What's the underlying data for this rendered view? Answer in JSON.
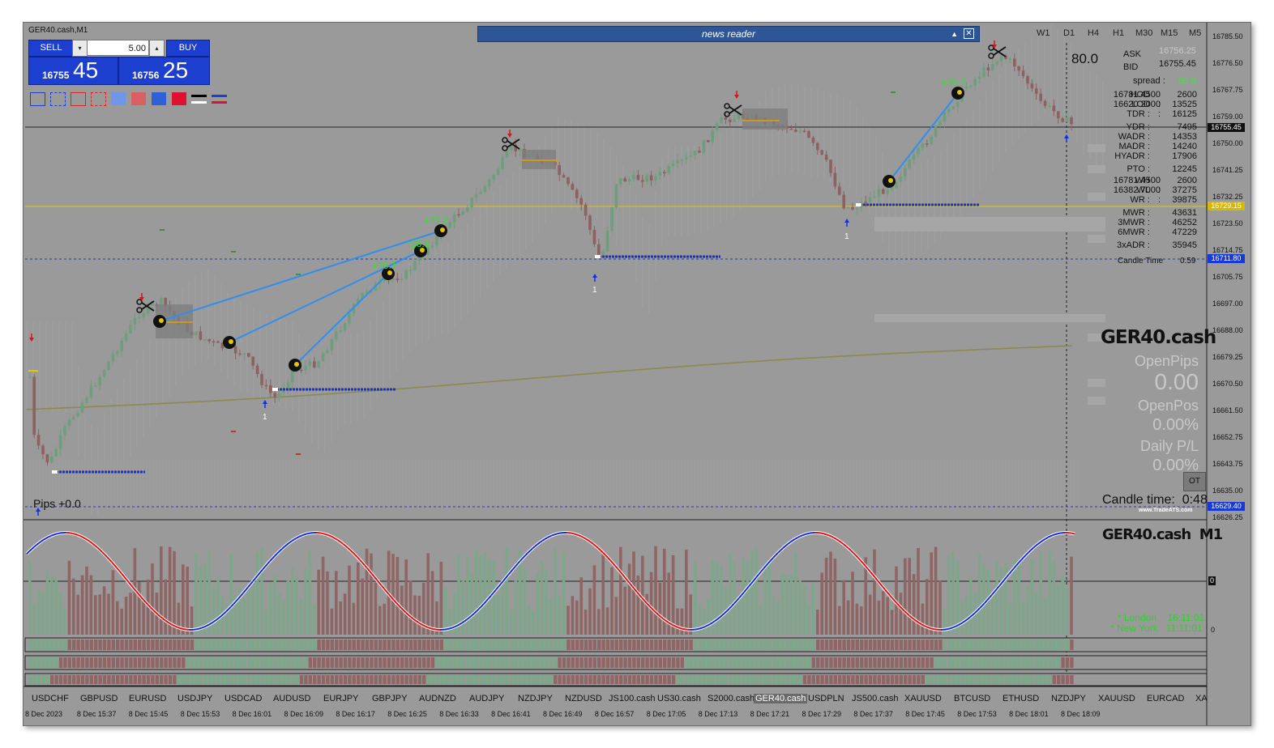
{
  "window": {
    "title": "GER40.cash,M1"
  },
  "trade_panel": {
    "sell_label": "SELL",
    "buy_label": "BUY",
    "lot": "5.00",
    "sell_small": "16755",
    "sell_big": "45",
    "buy_small": "16756",
    "buy_big": "25",
    "lot_down_arrow": "▾",
    "lot_up_arrow": "▴"
  },
  "news_reader": {
    "title": "news reader",
    "collapse": "▲",
    "close": "✕"
  },
  "timeframes": [
    "W1",
    "D1",
    "H4",
    "H1",
    "M30",
    "M15",
    "M5"
  ],
  "info_panel": {
    "spread_display": "80.0",
    "ask_label": "ASK",
    "ask_value": "16756.25",
    "bid_label": "BID",
    "bid_value": "16755.45",
    "spread_label": "spread :",
    "spread_value": "80.0",
    "rows": [
      {
        "label": "HOD",
        "value": "16781.4500 :",
        "num": "2600"
      },
      {
        "label": "LOD",
        "value": "16620.2000 :",
        "num": "13525"
      },
      {
        "label": "TDR :",
        "value": "",
        "num": "16125"
      },
      {
        "label": "YDR :",
        "value": "",
        "num": "7495"
      },
      {
        "label": "WADR :",
        "value": "",
        "num": "14353"
      },
      {
        "label": "MADR :",
        "value": "",
        "num": "14240"
      },
      {
        "label": "HYADR :",
        "value": "",
        "num": "17906"
      },
      {
        "label": "PTO :",
        "value": "",
        "num": "12245"
      },
      {
        "label": "WH",
        "value": "16781.4500 :",
        "num": "2600"
      },
      {
        "label": "WL",
        "value": "16382.7000 :",
        "num": "37275"
      },
      {
        "label": "WR :",
        "value": "",
        "num": "39875"
      },
      {
        "label": "MWR :",
        "value": "",
        "num": "43631"
      },
      {
        "label": "3MWR :",
        "value": "",
        "num": "46252"
      },
      {
        "label": "6MWR :",
        "value": "",
        "num": "47229"
      },
      {
        "label": "3xADR :",
        "value": "",
        "num": "35945"
      }
    ],
    "candle_time_label": "Candle Time",
    "candle_time_value": "0:59",
    "symbol": "GER40.cash",
    "open_pips_label": "OpenPips",
    "open_pips_value": "0.00",
    "open_pos_label": "OpenPos",
    "open_pos_value": "0.00%",
    "daily_pl_label": "Daily P/L",
    "daily_pl_value": "0.00%",
    "ot_button": "OT",
    "candle_time_big": "Candle time:  0:48",
    "website": "www.TradeATS.com"
  },
  "price_axis": [
    "16785.50",
    "16776.50",
    "16767.75",
    "16759.00",
    "16750.00",
    "16741.25",
    "16732.25",
    "16723.50",
    "16714.75",
    "16705.75",
    "16697.00",
    "16688.00",
    "16679.25",
    "16670.50",
    "16661.50",
    "16652.75",
    "16643.75",
    "16635.00",
    "16626.25"
  ],
  "price_tags": [
    {
      "text": "16755.45",
      "color": "#111111"
    },
    {
      "text": "16729.15",
      "color": "#d8b800"
    },
    {
      "text": "16711.80",
      "color": "#1838d8"
    },
    {
      "text": "16629.40",
      "color": "#1838d8"
    }
  ],
  "chart_labels": {
    "pips": "Pips +0.0",
    "profit_a": "+31.2",
    "profit_b": "+26.8",
    "profit_c": "+36.1",
    "profit_d": "+36.7",
    "count_1": "1"
  },
  "subchart": {
    "title": "GER40.cash  M1",
    "london": "* London    16:11:01",
    "new_york": "* New York   11:11:01",
    "zero": "0",
    "zero_b": "0"
  },
  "symbol_tabs": [
    "USDCHF",
    "GBPUSD",
    "EURUSD",
    "USDJPY",
    "USDCAD",
    "AUDUSD",
    "EURJPY",
    "GBPJPY",
    "AUDNZD",
    "AUDJPY",
    "NZDJPY",
    "NZDUSD",
    "JS100.cash",
    "US30.cash",
    "S2000.cash",
    "GER40.cash",
    "USDPLN",
    "JS500.cash",
    "XAUUSD",
    "BTCUSD",
    "ETHUSD",
    "NZDJPY",
    "XAUUSD",
    "EURCAD",
    "XA"
  ],
  "time_labels": [
    "8 Dec 2023",
    "8 Dec 15:37",
    "8 Dec 15:45",
    "8 Dec 15:53",
    "8 Dec 16:01",
    "8 Dec 16:09",
    "8 Dec 16:17",
    "8 Dec 16:25",
    "8 Dec 16:33",
    "8 Dec 16:41",
    "8 Dec 16:49",
    "8 Dec 16:57",
    "8 Dec 17:05",
    "8 Dec 17:13",
    "8 Dec 17:21",
    "8 Dec 17:29",
    "8 Dec 17:37",
    "8 Dec 17:45",
    "8 Dec 17:53",
    "8 Dec 18:01",
    "8 Dec 18:09"
  ],
  "colors": {
    "bull": "#7ea68a",
    "bear": "#8f6565",
    "accent": "#1c3fcf",
    "up_line": "#1228e0",
    "down_line": "#e21010"
  }
}
